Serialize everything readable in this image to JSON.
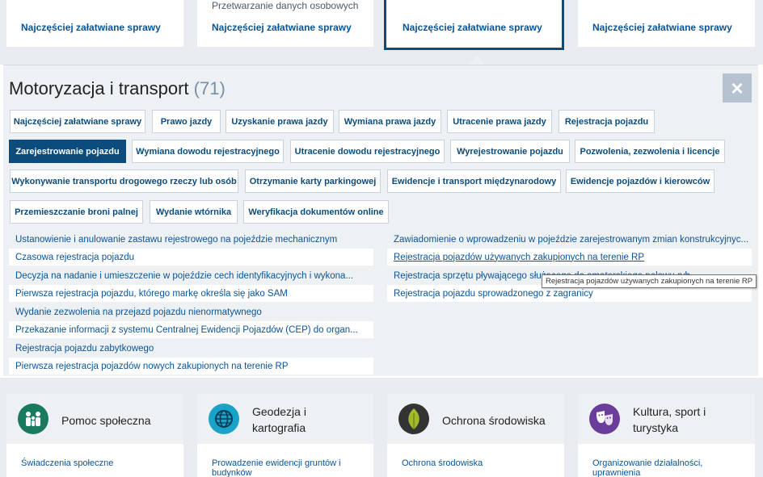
{
  "top_cards": [
    {
      "subtitle": "",
      "link": "Najczęściej załatwiane sprawy"
    },
    {
      "subtitle": "Przetwarzanie danych osobowych",
      "link": "Najczęściej załatwiane sprawy"
    },
    {
      "subtitle": "",
      "link": "Najczęściej załatwiane sprawy"
    },
    {
      "subtitle": "",
      "link": "Najczęściej załatwiane sprawy"
    }
  ],
  "panel": {
    "title": "Motoryzacja i transport",
    "count": "(71)",
    "close_label": "×",
    "chips": [
      "Najczęściej załatwiane sprawy",
      "Prawo jazdy",
      "Uzyskanie prawa jazdy",
      "Wymiana prawa jazdy",
      "Utracenie prawa jazdy",
      "Rejestracja pojazdu",
      "Zarejestrowanie pojazdu",
      "Wymiana dowodu rejestracyjnego",
      "Utracenie dowodu rejestracyjnego",
      "Wyrejestrowanie pojazdu",
      "Pozwolenia, zezwolenia i licencje",
      "Wykonywanie transportu drogowego rzeczy lub osób",
      "Otrzymanie karty parkingowej",
      "Ewidencje i transport międzynarodowy",
      "Ewidencje pojazdów i kierowców",
      "Przemieszczanie broni palnej",
      "Wydanie wtórnika",
      "Weryfikacja dokumentów online"
    ],
    "services_left": [
      "Ustanowienie i anulowanie zastawu rejestrowego na pojeździe mechanicznym",
      "Czasowa rejestracja pojazdu",
      "Decyzja na nadanie i umieszczenie w pojeździe cech identyfikacyjnych i wykona...",
      "Pierwsza rejestracja pojazdu, którego markę określa się jako SAM",
      "Wydanie zezwolenia na przejazd pojazdu nienormatywnego",
      "Przekazanie informacji z systemu Centralnej Ewidencji Pojazdów (CEP) do organ...",
      "Rejestracja pojazdu zabytkowego",
      "Pierwsza rejestracja pojazdów nowych zakupionych na terenie RP"
    ],
    "services_right": [
      "Zawiadomienie o wprowadzeniu w pojeździe zarejestrowanym zmian konstrukcyjnyc...",
      "Rejestracja pojazdów używanych zakupionych na terenie RP",
      "Rejestracja sprzętu pływającego służącego do amatorskiego połowu ryb",
      "Rejestracja pojazdu sprowadzonego z zagranicy"
    ],
    "tooltip": "Rejestracja pojazdów używanych zakupionych na terenie RP"
  },
  "categories": [
    {
      "name": "Pomoc społeczna",
      "icon": "family-icon",
      "color": "#1a7a5e",
      "link": "Świadczenia społeczne"
    },
    {
      "name": "Geodezja i kartografia",
      "icon": "globe-icon",
      "color": "#1aa3c8",
      "link": "Prowadzenie ewidencji gruntów i budynków"
    },
    {
      "name": "Ochrona środowiska",
      "icon": "leaf-icon",
      "color": "#333333",
      "link": "Ochrona środowiska"
    },
    {
      "name": "Kultura, sport i turystyka",
      "icon": "theater-masks-icon",
      "color": "#6a3d9a",
      "link": "Organizowanie działalności, uprawnienia"
    }
  ],
  "colors": {
    "accent": "#0b4c7c",
    "link": "#0b5394",
    "panel_bg": "#eef1f4"
  }
}
